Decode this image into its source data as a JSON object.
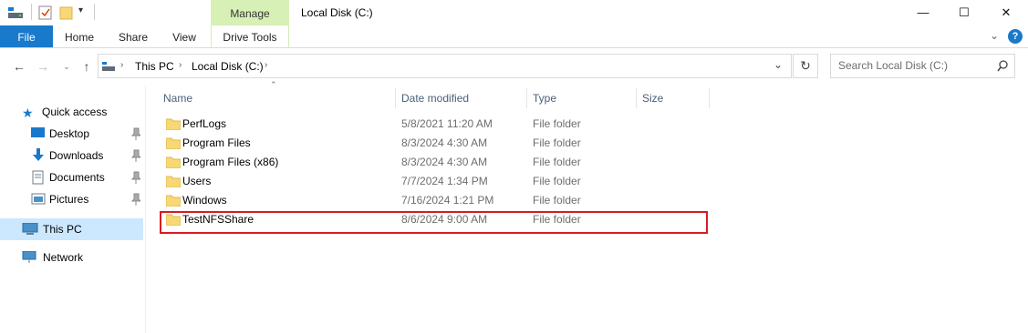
{
  "window": {
    "title": "Local Disk (C:)",
    "context_tab": "Manage",
    "minimize": "—",
    "maximize": "☐",
    "close": "✕"
  },
  "ribbon": {
    "tabs": [
      "File",
      "Home",
      "Share",
      "View",
      "Drive Tools"
    ]
  },
  "address": {
    "breadcrumb": [
      "This PC",
      "Local Disk (C:)"
    ],
    "search_placeholder": "Search Local Disk (C:)"
  },
  "nav": {
    "quick_access": "Quick access",
    "items": [
      "Desktop",
      "Downloads",
      "Documents",
      "Pictures"
    ],
    "this_pc": "This PC",
    "network": "Network"
  },
  "columns": [
    "Name",
    "Date modified",
    "Type",
    "Size"
  ],
  "files": [
    {
      "name": "PerfLogs",
      "date": "5/8/2021 11:20 AM",
      "type": "File folder"
    },
    {
      "name": "Program Files",
      "date": "8/3/2024 4:30 AM",
      "type": "File folder"
    },
    {
      "name": "Program Files (x86)",
      "date": "8/3/2024 4:30 AM",
      "type": "File folder"
    },
    {
      "name": "Users",
      "date": "7/7/2024 1:34 PM",
      "type": "File folder"
    },
    {
      "name": "Windows",
      "date": "7/16/2024 1:21 PM",
      "type": "File folder"
    },
    {
      "name": "TestNFSShare",
      "date": "8/6/2024 9:00 AM",
      "type": "File folder"
    }
  ],
  "colors": {
    "file_tab": "#1979ca",
    "manage_tab": "#d7f0b5",
    "selection": "#cce8ff",
    "highlight_box": "#d91b21",
    "folder": "#f8d775",
    "help": "#1979ca"
  }
}
